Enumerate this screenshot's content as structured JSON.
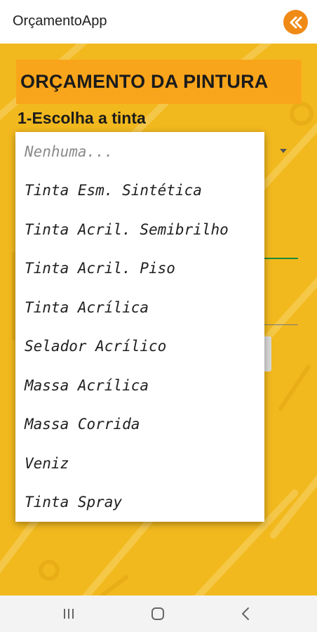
{
  "app": {
    "title": "OrçamentoApp",
    "accent": "#f08a16"
  },
  "header": {
    "title": "ORÇAMENTO DA PINTURA"
  },
  "step1": {
    "label": "1-Escolha a tinta"
  },
  "dropdown": {
    "placeholder": "Nenhuma...",
    "options": [
      "Tinta Esm. Sintética",
      "Tinta Acril. Semibrilho",
      "Tinta Acril. Piso",
      "Tinta Acrílica",
      "Selador Acrílico",
      "Massa Acrílica",
      "Massa Corrida",
      "Veniz",
      "Tinta Spray"
    ]
  },
  "navbar": {
    "recents_icon": "recents-icon",
    "home_icon": "home-icon",
    "back_icon": "back-icon"
  },
  "colors": {
    "background": "#f2b91e",
    "header_box": "#f9a51b"
  }
}
